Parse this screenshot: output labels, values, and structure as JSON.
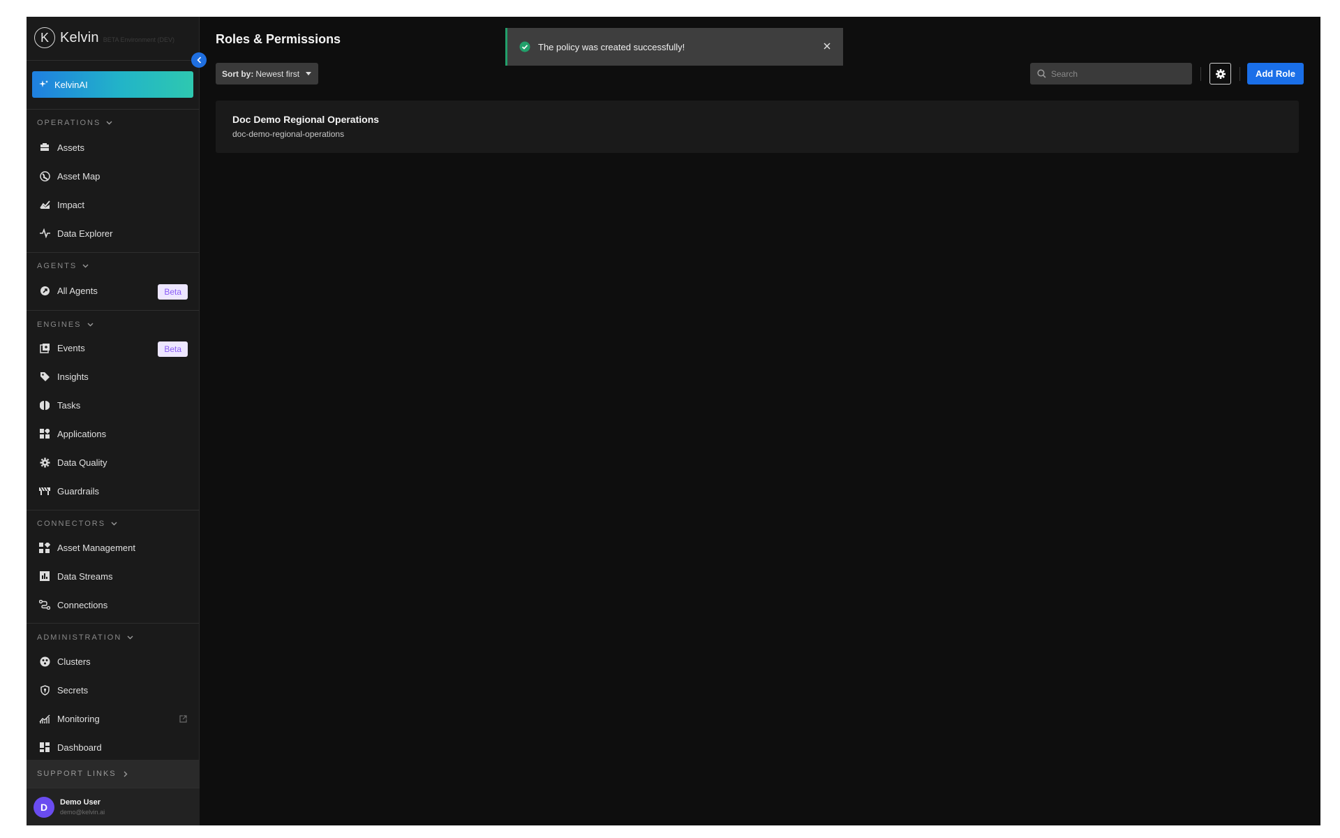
{
  "brand": {
    "name": "Kelvin",
    "env": "BETA Environment (DEV)",
    "logo_letter": "K"
  },
  "kelvinai": {
    "label": "KelvinAI"
  },
  "sections": [
    {
      "title": "OPERATIONS",
      "items": [
        {
          "label": "Assets",
          "icon": "assets-icon"
        },
        {
          "label": "Asset Map",
          "icon": "globe-icon"
        },
        {
          "label": "Impact",
          "icon": "impact-icon"
        },
        {
          "label": "Data Explorer",
          "icon": "pulse-icon"
        }
      ]
    },
    {
      "title": "AGENTS",
      "items": [
        {
          "label": "All Agents",
          "icon": "agent-icon",
          "badge": "Beta"
        }
      ]
    },
    {
      "title": "ENGINES",
      "items": [
        {
          "label": "Events",
          "icon": "events-icon",
          "badge": "Beta"
        },
        {
          "label": "Insights",
          "icon": "tag-icon"
        },
        {
          "label": "Tasks",
          "icon": "tasks-icon"
        },
        {
          "label": "Applications",
          "icon": "applications-icon"
        },
        {
          "label": "Data Quality",
          "icon": "data-quality-icon"
        },
        {
          "label": "Guardrails",
          "icon": "guardrails-icon"
        }
      ]
    },
    {
      "title": "CONNECTORS",
      "items": [
        {
          "label": "Asset Management",
          "icon": "asset-management-icon"
        },
        {
          "label": "Data Streams",
          "icon": "data-streams-icon"
        },
        {
          "label": "Connections",
          "icon": "connections-icon"
        }
      ]
    },
    {
      "title": "ADMINISTRATION",
      "items": [
        {
          "label": "Clusters",
          "icon": "clusters-icon"
        },
        {
          "label": "Secrets",
          "icon": "shield-icon"
        },
        {
          "label": "Monitoring",
          "icon": "monitoring-icon",
          "external": true
        },
        {
          "label": "Dashboard",
          "icon": "dashboard-icon"
        }
      ]
    }
  ],
  "support": {
    "label": "SUPPORT LINKS"
  },
  "user": {
    "initial": "D",
    "name": "Demo User",
    "email": "demo@kelvin.ai"
  },
  "page": {
    "title": "Roles & Permissions"
  },
  "sort": {
    "label": "Sort by:",
    "value": "Newest first"
  },
  "search": {
    "placeholder": "Search",
    "value": ""
  },
  "actions": {
    "add_role": "Add Role"
  },
  "roles": [
    {
      "name": "Doc Demo Regional Operations",
      "slug": "doc-demo-regional-operations"
    }
  ],
  "toast": {
    "message": "The policy was created successfully!",
    "status": "success"
  },
  "colors": {
    "accent": "#1a6fe8",
    "success": "#22a06b",
    "beta_text": "#8a5cf5",
    "beta_bg": "#ede6ff"
  }
}
